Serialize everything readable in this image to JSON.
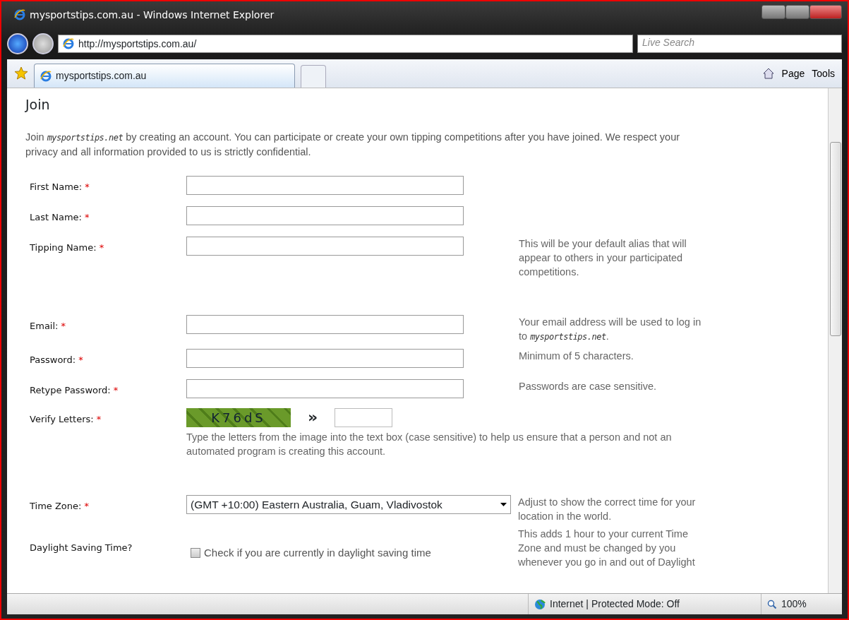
{
  "window": {
    "title": "mysportstips.com.au - Windows Internet Explorer"
  },
  "address_bar": {
    "url": "http://mysportstips.com.au/",
    "search_placeholder": "Live Search"
  },
  "tabs": [
    {
      "label": "mysportstips.com.au",
      "selected": true
    }
  ],
  "command_bar": [
    "Page",
    "Tools"
  ],
  "page": {
    "heading": "Join",
    "intro": {
      "before": "Join",
      "brand": "mysportstips.net",
      "after": "by creating an account. You can participate or create your own tipping competitions after you have joined. We respect your privacy and all information provided to us is strictly confidential."
    },
    "fields": [
      {
        "kind": "text",
        "label": "First Name:",
        "required": true
      },
      {
        "kind": "text",
        "label": "Last Name:",
        "required": true
      },
      {
        "kind": "text",
        "label": "Tipping Name:",
        "required": true,
        "hint": "This will be your default alias that will appear to others in your participated competitions."
      },
      {
        "kind": "text",
        "label": "Email:",
        "required": true,
        "hint": "Your email address will be used to log in to",
        "hint_brand": "mysportstips.net",
        "hint_after": "."
      },
      {
        "kind": "password",
        "label": "Password:",
        "required": true,
        "hint": "Minimum of 5 characters."
      },
      {
        "kind": "password",
        "label": "Retype Password:",
        "required": true,
        "hint": "Passwords are case sensitive."
      },
      {
        "kind": "captcha",
        "label": "Verify Letters:",
        "required": true,
        "captcha_text": "K76dS",
        "arrow": "»",
        "note": "Type the letters from the image into the text box (case sensitive) to help us ensure that a person and not an automated program is creating this account."
      },
      {
        "kind": "select",
        "label": "Time Zone:",
        "required": true,
        "value": "(GMT +10:00) Eastern Australia, Guam, Vladivostok",
        "hint": "Adjust to show the correct time for your location in the world."
      },
      {
        "kind": "checkbox",
        "label": "Daylight Saving Time?",
        "required": false,
        "checkbox_label": "Check if you are currently in daylight saving time",
        "checked": false,
        "hint": "This adds 1 hour to your current Time Zone and must be changed by you whenever you go in and out of Daylight"
      }
    ],
    "required_mark": "*"
  },
  "status_bar": {
    "zone": "Internet | Protected Mode: Off",
    "zoom": "100%"
  }
}
